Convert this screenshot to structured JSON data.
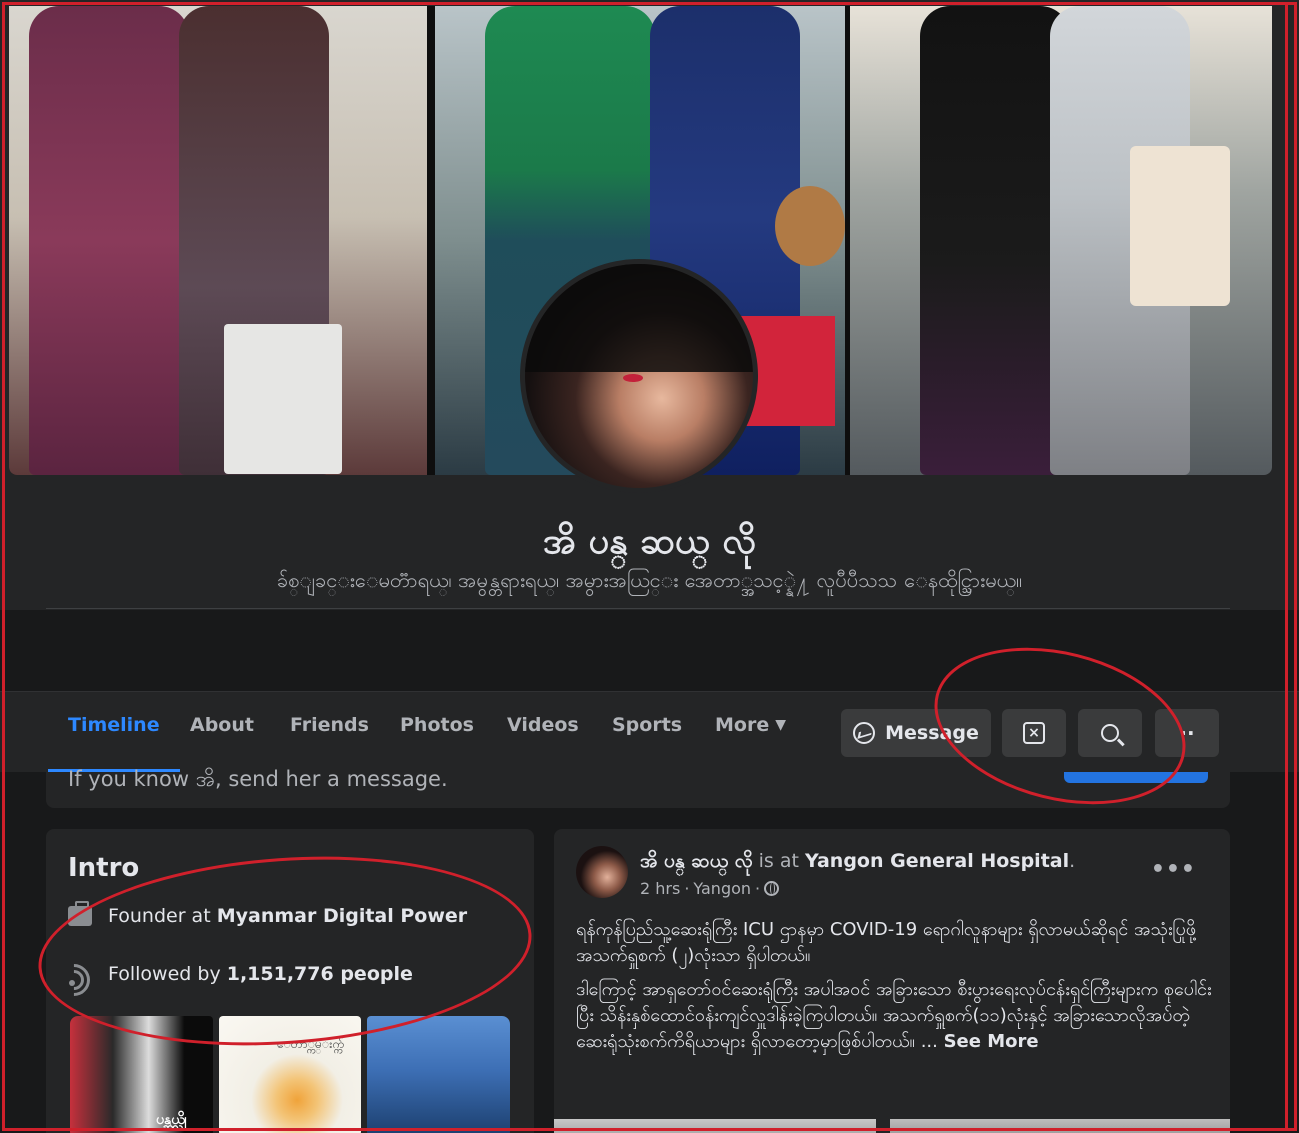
{
  "profile": {
    "name": "အိ ပန္ ဆယ္ လို",
    "bio": "ခ်စ္ျခင္းေမတၱာရယ္၊ အမွန္တရားရယ္၊ အမွားအယြင္း အေတာ္အသင့္နဲ႔ လူပီပီသသ ေနထိုင္သြားမယ္။"
  },
  "nav": {
    "tabs": [
      {
        "label": "Timeline",
        "active": true
      },
      {
        "label": "About"
      },
      {
        "label": "Friends"
      },
      {
        "label": "Photos"
      },
      {
        "label": "Videos"
      },
      {
        "label": "Sports"
      },
      {
        "label": "More"
      }
    ],
    "message_label": "Message",
    "dots_label": "··"
  },
  "prompt": {
    "text": "If you know အိ, send her a message."
  },
  "intro": {
    "title": "Intro",
    "work_prefix": "Founder at ",
    "work_place": "Myanmar Digital Power",
    "followers_prefix": "Followed by ",
    "followers_count": "1,151,776 people",
    "thumb_labels": [
      "ပန္ဆယ္လို",
      "ေတာ္ကမ္းက္က်"
    ]
  },
  "post": {
    "author": "အိ ပန္ ဆယ္ လို",
    "is_at": " is at ",
    "place": "Yangon General Hospital",
    "period": ".",
    "time": "2 hrs",
    "location": "Yangon",
    "sep": " · ",
    "more": "•••",
    "paragraph_1": "ရန်ကုန်ပြည်သူ့ဆေးရုံကြီး ICU ဌာနမှာ COVID-19 ရောဂါလူနာများ ရှိလာမယ်ဆိုရင် အသုံးပြုဖို့ အသက်ရှူစက် (၂)လုံးသာ ရှိပါတယ်။",
    "paragraph_2": "ဒါကြောင့် အာရှတော်ဝင်ဆေးရုံကြီး အပါအဝင် အခြားသော စီးပွားရေးလုပ်ငန်းရှင်ကြီးများက စုပေါင်းပြီး သိန်းနှစ်ထောင်ဝန်းကျင်လှူဒါန်းခဲ့ကြပါတယ်။ အသက်ရှူစက်(၁၁)လုံးနှင့် အခြားသောလိုအပ်တဲ့ ဆေးရုံသုံးစက်ကိရိယာများ ရှိလာတော့မှာဖြစ်ပါတယ်။ ... ",
    "see_more": "See More"
  },
  "colors": {
    "accent": "#2d88ff",
    "annotation": "#d0202b",
    "card": "#242526",
    "background": "#18191a"
  }
}
